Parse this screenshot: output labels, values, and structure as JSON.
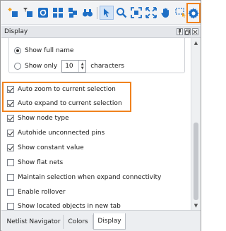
{
  "toolbar": {
    "icons": [
      "plus-node-icon",
      "filter-node-icon",
      "refresh-icon",
      "grid-icon",
      "stack-icon",
      "binoculars-icon",
      "pointer-icon",
      "zoom-icon",
      "fit-icon",
      "expand-icon",
      "hand-icon",
      "select-rect-icon",
      "magic-wand-icon",
      "settings-icon"
    ]
  },
  "panel": {
    "title": "Display"
  },
  "options": {
    "show_full_name": "Show full name",
    "show_only": "Show only",
    "show_only_value": "10",
    "characters": "characters",
    "auto_zoom": "Auto zoom to current selection",
    "auto_expand": "Auto expand to current selection",
    "show_node_type": "Show node type",
    "autohide_unconnected": "Autohide unconnected pins",
    "show_constant_value": "Show constant value",
    "show_flat_nets": "Show flat nets",
    "maintain_selection": "Maintain selection when expand connectivity",
    "enable_rollover": "Enable rollover",
    "show_located": "Show located objects in new tab"
  },
  "tabs": [
    "Netlist Navigator",
    "Colors",
    "Display"
  ],
  "colors": {
    "accent_highlight": "#f0821e",
    "icon_blue": "#1f6fc5"
  }
}
